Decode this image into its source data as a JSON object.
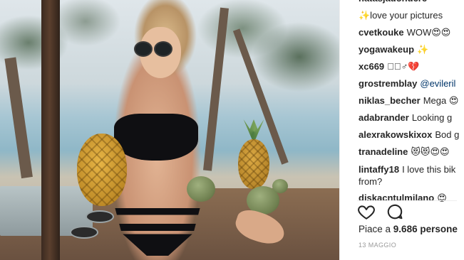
{
  "comments": [
    {
      "user": "",
      "text": "✨love your pictures"
    },
    {
      "user": "cvetkouke",
      "text": "WOW😍😍"
    },
    {
      "user": "yogawakeup",
      "text": "✨"
    },
    {
      "user": "xc669",
      "text": "◻🏽♂💔"
    },
    {
      "user": "grostremblay",
      "text": "",
      "mention": "@evileril"
    },
    {
      "user": "niklas_becher",
      "text": "Mega 😍"
    },
    {
      "user": "adabrander",
      "text": "Looking g"
    },
    {
      "user": "alexrakowskixox",
      "text": "Bod g"
    },
    {
      "user": "tranadeline",
      "text": "😻😻😍😍"
    },
    {
      "user": "lintaffy18",
      "text": "I love this bik from?"
    },
    {
      "user": "diskacntulmilano",
      "text": "😍"
    }
  ],
  "likes": {
    "prefix": "Piace a",
    "count": "9.686",
    "suffix": "persone"
  },
  "date": "13 MAGGIO",
  "icons": {
    "like": "heart-icon",
    "comment": "comment-bubble-icon"
  },
  "colors": {
    "text": "#262626",
    "mention": "#003569",
    "muted": "#999999"
  }
}
